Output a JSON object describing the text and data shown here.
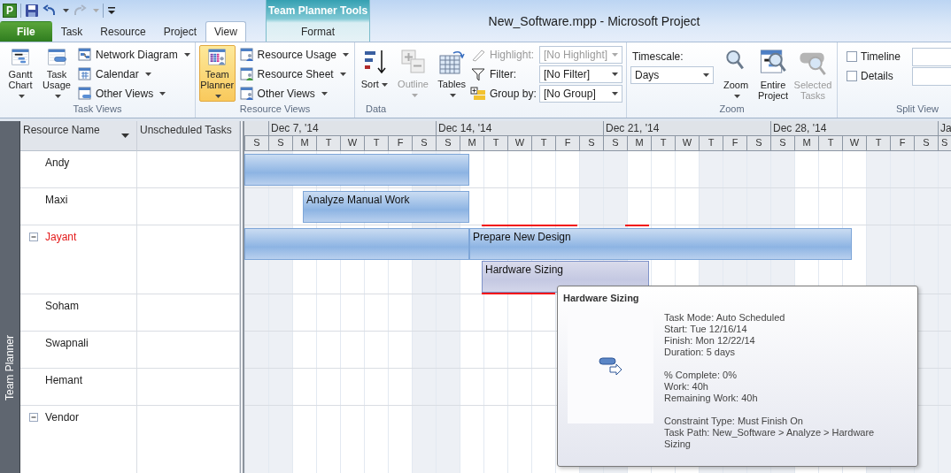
{
  "app_logo": "P",
  "window": {
    "title": "New_Software.mpp  -  Microsoft Project"
  },
  "contextual_group": {
    "label": "Team Planner Tools"
  },
  "tabs": [
    {
      "label": "File",
      "kind": "file",
      "selected": false
    },
    {
      "label": "Task",
      "kind": "normal",
      "selected": false
    },
    {
      "label": "Resource",
      "kind": "normal",
      "selected": false
    },
    {
      "label": "Project",
      "kind": "normal",
      "selected": false
    },
    {
      "label": "View",
      "kind": "normal",
      "selected": true
    },
    {
      "label": "Format",
      "kind": "contextual",
      "selected": false
    }
  ],
  "ribbon": {
    "task_views": {
      "label": "Task Views",
      "large_buttons": [
        {
          "label": "Gantt Chart",
          "dropdown": true,
          "selected": false
        },
        {
          "label": "Task Usage",
          "dropdown": true,
          "selected": false
        }
      ],
      "small_buttons": [
        {
          "label": "Network Diagram",
          "dropdown": true
        },
        {
          "label": "Calendar",
          "dropdown": true
        },
        {
          "label": "Other Views",
          "dropdown": true
        }
      ]
    },
    "resource_views": {
      "label": "Resource Views",
      "large_buttons": [
        {
          "label": "Team Planner",
          "dropdown": true,
          "selected": true
        }
      ],
      "small_buttons": [
        {
          "label": "Resource Usage",
          "dropdown": true
        },
        {
          "label": "Resource Sheet",
          "dropdown": true
        },
        {
          "label": "Other Views",
          "dropdown": true
        }
      ]
    },
    "data": {
      "label": "Data",
      "large_buttons": [
        {
          "label": "Sort",
          "dropdown": true,
          "disabled": false
        },
        {
          "label": "Outline",
          "dropdown": true,
          "disabled": true
        },
        {
          "label": "Tables",
          "dropdown": true,
          "disabled": false
        }
      ],
      "fields": [
        {
          "label": "Highlight:",
          "value": "[No Highlight]",
          "disabled": true
        },
        {
          "label": "Filter:",
          "value": "[No Filter]",
          "disabled": false
        },
        {
          "label": "Group by:",
          "value": "[No Group]",
          "disabled": false
        }
      ]
    },
    "zoom": {
      "label": "Zoom",
      "timescale": {
        "label": "Timescale:",
        "value": "Days"
      },
      "large_buttons": [
        {
          "label": "Zoom",
          "dropdown": true,
          "disabled": false
        },
        {
          "label": "Entire Project",
          "dropdown": false,
          "disabled": false
        },
        {
          "label": "Selected Tasks",
          "dropdown": false,
          "disabled": true
        }
      ]
    },
    "split_view": {
      "label": "Split View",
      "checkboxes": [
        {
          "label": "Timeline",
          "checked": false
        },
        {
          "label": "Details",
          "checked": false
        }
      ]
    }
  },
  "view_bar": {
    "label": "Team Planner"
  },
  "columns": [
    "Resource Name",
    "Unscheduled Tasks"
  ],
  "weeks": [
    "Dec 7, '14",
    "Dec 14, '14",
    "Dec 21, '14",
    "Dec 28, '14",
    "Ja"
  ],
  "days": [
    {
      "label": "S",
      "shaded": true
    },
    {
      "label": "S",
      "shaded": true
    },
    {
      "label": "M",
      "shaded": false
    },
    {
      "label": "T",
      "shaded": false
    },
    {
      "label": "W",
      "shaded": false
    },
    {
      "label": "T",
      "shaded": false
    },
    {
      "label": "F",
      "shaded": false
    },
    {
      "label": "S",
      "shaded": true
    },
    {
      "label": "S",
      "shaded": true
    },
    {
      "label": "M",
      "shaded": false
    },
    {
      "label": "T",
      "shaded": false
    },
    {
      "label": "W",
      "shaded": false
    },
    {
      "label": "T",
      "shaded": false
    },
    {
      "label": "F",
      "shaded": false
    },
    {
      "label": "S",
      "shaded": true
    },
    {
      "label": "S",
      "shaded": true
    },
    {
      "label": "M",
      "shaded": false
    },
    {
      "label": "T",
      "shaded": false
    },
    {
      "label": "W",
      "shaded": false
    },
    {
      "label": "T",
      "shaded": true
    },
    {
      "label": "F",
      "shaded": true
    },
    {
      "label": "S",
      "shaded": true
    },
    {
      "label": "S",
      "shaded": true
    },
    {
      "label": "M",
      "shaded": false
    },
    {
      "label": "T",
      "shaded": false
    },
    {
      "label": "W",
      "shaded": false
    },
    {
      "label": "T",
      "shaded": true
    },
    {
      "label": "F",
      "shaded": true
    },
    {
      "label": "S",
      "shaded": true
    },
    {
      "label": "S",
      "shaded": true
    }
  ],
  "resources": [
    {
      "name": "Andy",
      "collapsible": false,
      "overallocated": false,
      "tasks": [
        {
          "selected": false
        }
      ]
    },
    {
      "name": "Maxi",
      "collapsible": false,
      "overallocated": false,
      "tasks": [
        {
          "label": "Analyze Manual Work",
          "selected": false
        }
      ]
    },
    {
      "name": "Jayant",
      "collapsible": true,
      "expanded": true,
      "overallocated": true,
      "tasks": [
        {
          "selected": false
        },
        {
          "label": "Prepare New Design",
          "selected": false
        },
        {
          "label": "Hardware Sizing",
          "selected": true
        }
      ]
    },
    {
      "name": "Soham",
      "collapsible": false,
      "overallocated": false
    },
    {
      "name": "Swapnali",
      "collapsible": false,
      "overallocated": false
    },
    {
      "name": "Hemant",
      "collapsible": false,
      "overallocated": false
    },
    {
      "name": "Vendor",
      "collapsible": true,
      "expanded": true,
      "overallocated": false
    }
  ],
  "tooltip": {
    "title": "Hardware Sizing",
    "sections": [
      [
        "Task Mode: Auto Scheduled",
        "Start: Tue 12/16/14",
        "Finish: Mon 12/22/14",
        "Duration: 5 days"
      ],
      [
        "% Complete: 0%",
        "Work: 40h",
        "Remaining Work: 40h"
      ],
      [
        "Constraint Type: Must Finish On",
        "Task Path: New_Software > Analyze > Hardware Sizing"
      ]
    ]
  }
}
